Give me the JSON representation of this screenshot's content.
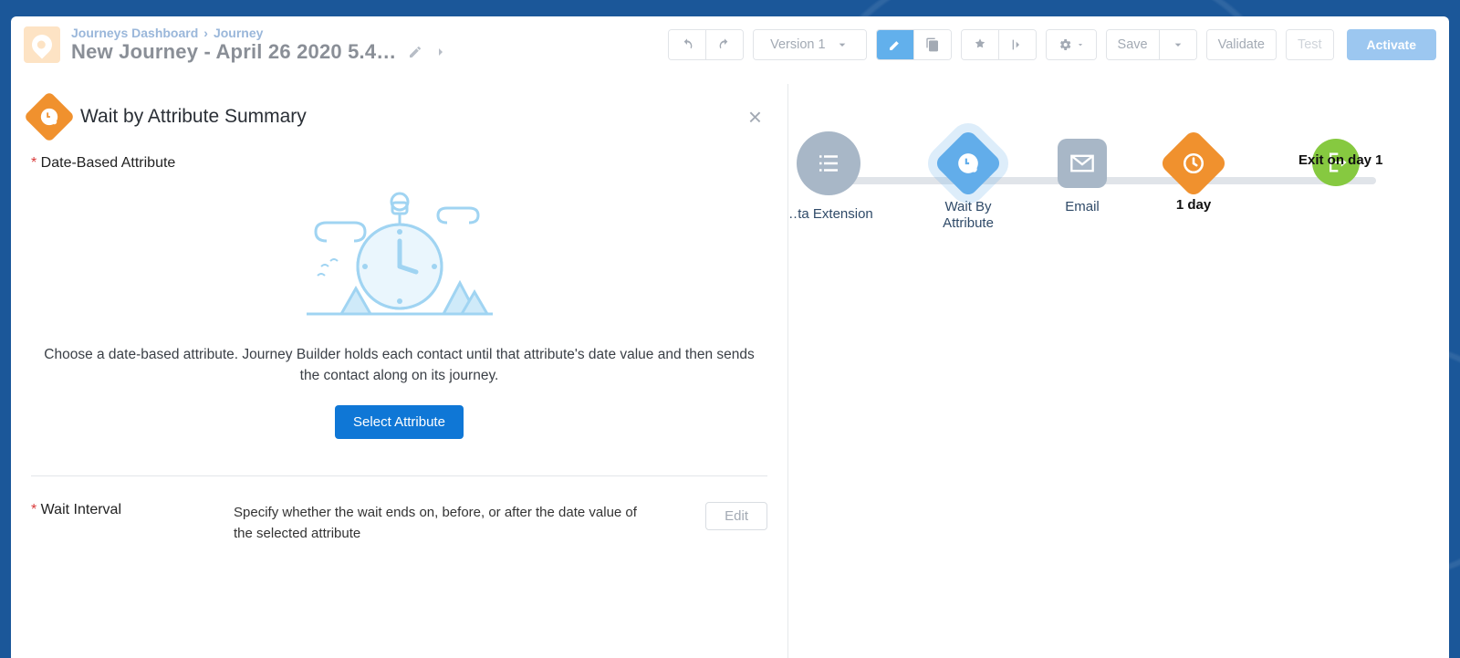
{
  "header": {
    "crumb1": "Journeys Dashboard",
    "crumb2": "Journey",
    "title": "New Journey - April 26 2020 5.4…",
    "versionLabel": "Version 1",
    "saveLabel": "Save",
    "validateLabel": "Validate",
    "testLabel": "Test",
    "activateLabel": "Activate"
  },
  "panel": {
    "title": "Wait by Attribute Summary",
    "section1": "Date-Based Attribute",
    "desc": "Choose a date-based attribute. Journey Builder holds each contact until that attribute's date value and then sends the contact along on its journey.",
    "selectBtn": "Select Attribute",
    "section2": "Wait Interval",
    "section2Desc": "Specify whether the wait ends on, before, or after the date value of the selected attribute",
    "editBtn": "Edit"
  },
  "flow": {
    "node1": "…ta Extension",
    "node2a": "Wait By",
    "node2b": "Attribute",
    "node3": "Email",
    "node4": "1 day",
    "exit": "Exit on day 1"
  }
}
